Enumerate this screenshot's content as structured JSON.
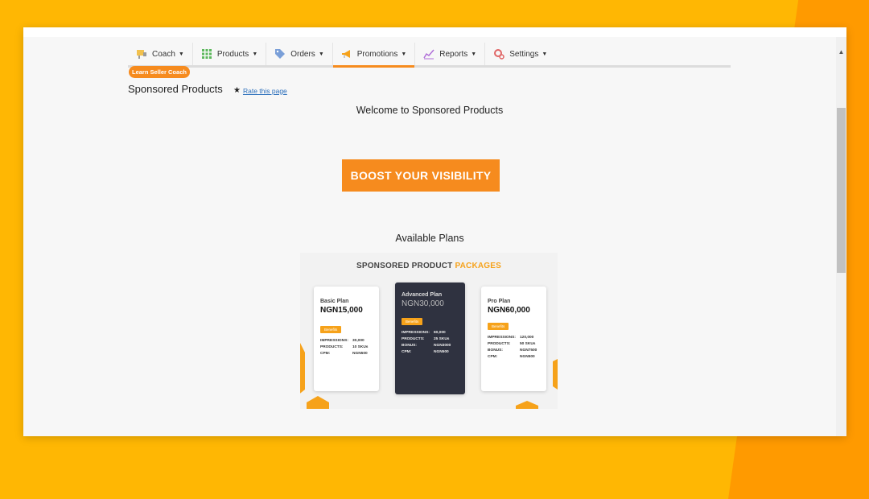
{
  "nav": {
    "items": [
      {
        "label": "Coach",
        "icon": "coach-icon",
        "active": false
      },
      {
        "label": "Products",
        "icon": "grid-icon",
        "active": false
      },
      {
        "label": "Orders",
        "icon": "tag-icon",
        "active": false
      },
      {
        "label": "Promotions",
        "icon": "megaphone-icon",
        "active": true
      },
      {
        "label": "Reports",
        "icon": "chart-line-icon",
        "active": false
      },
      {
        "label": "Settings",
        "icon": "gear-icon",
        "active": false
      }
    ]
  },
  "coach_badge": "Learn Seller Coach",
  "page_title": "Sponsored Products",
  "rate_link": "Rate this page",
  "welcome": "Welcome to Sponsored Products",
  "boost_button": "BOOST YOUR VISIBILITY",
  "plans_title": "Available Plans",
  "promo": {
    "heading_main": "SPONSORED PRODUCT ",
    "heading_accent": "PACKAGES",
    "plans": [
      {
        "name": "Basic Plan",
        "price": "NGN15,000",
        "benefits": "Benefits",
        "rows": [
          [
            "IMPRESSIONS:",
            "30,000"
          ],
          [
            "PRODUCTS:",
            "10 SKUs"
          ],
          [
            "CPM:",
            "NGN500"
          ]
        ]
      },
      {
        "name": "Advanced Plan",
        "price": "NGN30,000",
        "benefits": "Benefits",
        "rows": [
          [
            "IMPRESSIONS:",
            "60,000"
          ],
          [
            "PRODUCTS:",
            "25 SKUs"
          ],
          [
            "BONUS:",
            "NGN3000"
          ],
          [
            "CPM:",
            "NGN500"
          ]
        ]
      },
      {
        "name": "Pro Plan",
        "price": "NGN60,000",
        "benefits": "Benefits",
        "rows": [
          [
            "IMPRESSIONS:",
            "120,000"
          ],
          [
            "PRODUCTS:",
            "50 SKUs"
          ],
          [
            "BONUS:",
            "NGN7500"
          ],
          [
            "CPM:",
            "NGN500"
          ]
        ]
      }
    ]
  },
  "colors": {
    "accent": "#f68b1e",
    "background": "#ffb703",
    "dark_card": "#2f3240"
  }
}
